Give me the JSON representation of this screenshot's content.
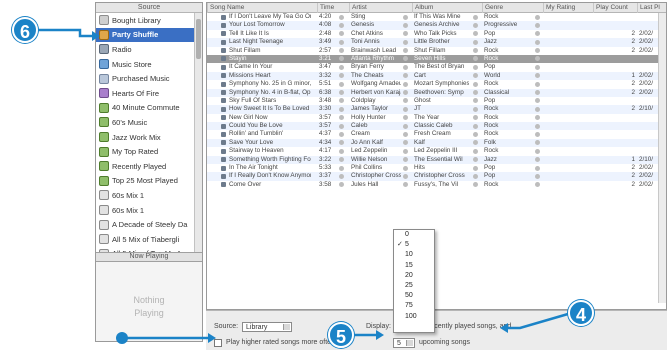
{
  "sidebar": {
    "header": "Source",
    "items": [
      {
        "label": "Bought Library",
        "icon": "library-icon"
      },
      {
        "label": "Party Shuffle",
        "icon": "party-shuffle-icon",
        "selected": true
      },
      {
        "label": "Radio",
        "icon": "radio-icon"
      },
      {
        "label": "Music Store",
        "icon": "music-store-icon"
      },
      {
        "label": "Purchased Music",
        "icon": "purchased-music-icon"
      },
      {
        "label": "Hearts Of Fire",
        "icon": "podcast-icon"
      },
      {
        "label": "40 Minute Commute",
        "icon": "smart-playlist-icon"
      },
      {
        "label": "60's Music",
        "icon": "smart-playlist-icon"
      },
      {
        "label": "Jazz Work Mix",
        "icon": "smart-playlist-icon"
      },
      {
        "label": "My Top Rated",
        "icon": "smart-playlist-icon"
      },
      {
        "label": "Recently Played",
        "icon": "smart-playlist-icon"
      },
      {
        "label": "Top 25 Most Played",
        "icon": "smart-playlist-icon"
      },
      {
        "label": "60s Mix 1",
        "icon": "playlist-icon"
      },
      {
        "label": "60s Mix 1",
        "icon": "playlist-icon"
      },
      {
        "label": "A Decade of Steely Da",
        "icon": "playlist-icon"
      },
      {
        "label": "All 5 Mix of Tiabergli",
        "icon": "playlist-icon"
      },
      {
        "label": "All 5 Mix of Top My A",
        "icon": "playlist-icon"
      }
    ],
    "now_playing_header": "Now Playing",
    "now_playing_line1": "Nothing",
    "now_playing_line2": "Playing"
  },
  "songlist": {
    "columns": [
      "Song Name",
      "Time",
      "Artist",
      "Album",
      "Genre",
      "My Rating",
      "Play Count",
      "Last Pl"
    ],
    "rows": [
      {
        "name": "If I Don't Leave My Tea Go Or You",
        "time": "4:20",
        "artist": "Sting",
        "album": "If This Was Mine",
        "genre": "Rock",
        "count": "",
        "last": ""
      },
      {
        "name": "Your Lost Tomorrow",
        "time": "4:08",
        "artist": "Genesis",
        "album": "Genesis Archive",
        "genre": "Progressive",
        "count": "",
        "last": ""
      },
      {
        "name": "Tell It Like It Is",
        "time": "2:48",
        "artist": "Chet Atkins",
        "album": "Who Talk Picks",
        "genre": "Pop",
        "count": "2",
        "last": "2/02/"
      },
      {
        "name": "Last Night Teenage",
        "time": "3:49",
        "artist": "Toni Annis",
        "album": "Little Brother",
        "genre": "Jazz",
        "count": "2",
        "last": "2/02/"
      },
      {
        "name": "Shut Fillam",
        "time": "2:57",
        "artist": "Brainwash Lead",
        "album": "Shut Fillam",
        "genre": "Rock",
        "count": "2",
        "last": "2/02/"
      },
      {
        "name": "Stayin",
        "time": "3:21",
        "artist": "Atlanta Rhythm",
        "album": "Seven Hills",
        "genre": "Rock",
        "count": "",
        "last": "",
        "playing": true
      },
      {
        "name": "It Came In Your",
        "time": "3:47",
        "artist": "Bryan Ferry",
        "album": "The Best of Bryan",
        "genre": "Pop",
        "count": "",
        "last": ""
      },
      {
        "name": "Missions Heart",
        "time": "3:32",
        "artist": "The Cheats",
        "album": "Cart",
        "genre": "World",
        "count": "1",
        "last": "2/02/"
      },
      {
        "name": "Symphony No. 25 in G minor, K. 183 - Allegro",
        "time": "5:51",
        "artist": "Wolfgang Amadeus",
        "album": "Mozart Symphonies",
        "genre": "Rock",
        "count": "2",
        "last": "2/02/"
      },
      {
        "name": "Symphony No. 4 in B-flat, Op. 60",
        "time": "6:38",
        "artist": "Herbert von Karajan",
        "album": "Beethoven: Symp",
        "genre": "Classical",
        "count": "2",
        "last": "2/02/"
      },
      {
        "name": "Sky Full Of Stars",
        "time": "3:48",
        "artist": "Coldplay",
        "album": "Ghost",
        "genre": "Pop",
        "count": "",
        "last": ""
      },
      {
        "name": "How Sweet It Is To Be Loved",
        "time": "3:30",
        "artist": "James Taylor",
        "album": "JT",
        "genre": "Rock",
        "count": "2",
        "last": "2/10/"
      },
      {
        "name": "New Girl Now",
        "time": "3:57",
        "artist": "Holly Hunter",
        "album": "The Year",
        "genre": "Rock",
        "count": "",
        "last": ""
      },
      {
        "name": "Could You Be Love",
        "time": "3:57",
        "artist": "Caleb",
        "album": "Classic Caleb",
        "genre": "Rock",
        "count": "",
        "last": ""
      },
      {
        "name": "Rollin' and Tumblin'",
        "time": "4:37",
        "artist": "Cream",
        "album": "Fresh Cream",
        "genre": "Rock",
        "count": "",
        "last": ""
      },
      {
        "name": "Save Your Love",
        "time": "4:34",
        "artist": "Jo Ann Kalf",
        "album": "Kalf",
        "genre": "Folk",
        "count": "",
        "last": ""
      },
      {
        "name": "Stairway to Heaven",
        "time": "4:17",
        "artist": "Led Zeppelin",
        "album": "Led Zeppelin III",
        "genre": "Rock",
        "count": "",
        "last": ""
      },
      {
        "name": "Something Worth Fighting For",
        "time": "3:22",
        "artist": "Willie Nelson",
        "album": "The Essential Wil",
        "genre": "Jazz",
        "count": "1",
        "last": "2/10/"
      },
      {
        "name": "In The Air Tonight",
        "time": "5:33",
        "artist": "Phil Collins",
        "album": "Hits",
        "genre": "Pop",
        "count": "2",
        "last": "2/02/"
      },
      {
        "name": "If I Really Don't Know Anymore",
        "time": "3:37",
        "artist": "Christopher Cross",
        "album": "Christopher Cross",
        "genre": "Pop",
        "count": "2",
        "last": "2/02/"
      },
      {
        "name": "Come Over",
        "time": "3:58",
        "artist": "Jules Hall",
        "album": "Fussy's, The Vil",
        "genre": "Rock",
        "count": "2",
        "last": "2/02/"
      }
    ]
  },
  "bottom": {
    "source_label": "Source:",
    "source_value": "Library",
    "display_label": "Display:",
    "display_text": "recently played songs, and",
    "play_higher_label": "Play higher rated songs more often",
    "upcoming_value": "5",
    "upcoming_text": "upcoming songs"
  },
  "menu": {
    "items": [
      "0",
      "5",
      "10",
      "15",
      "20",
      "25",
      "50",
      "75",
      "100"
    ],
    "checked": "5"
  },
  "callouts": {
    "c4": "4",
    "c5": "5",
    "c6": "6",
    "color": "#1b83c7"
  }
}
